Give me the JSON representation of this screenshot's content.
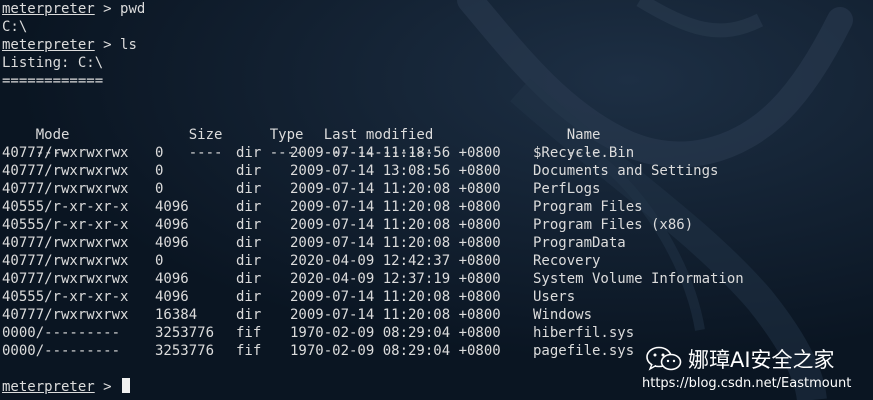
{
  "terminal": {
    "prompt": "meterpreter",
    "prompt_sep": " > ",
    "cmd1": "pwd",
    "out1": "C:\\",
    "cmd2": "ls",
    "listing": "Listing: C:\\",
    "underline": "============",
    "headers": {
      "mode": "Mode",
      "size": "Size",
      "type": "Type",
      "modified": "Last modified",
      "name": "Name"
    },
    "dashes": {
      "mode": "----",
      "size": "----",
      "type": "----",
      "modified": "-------------",
      "name": "----"
    },
    "rows": [
      {
        "mode": "40777/rwxrwxrwx",
        "size": "0",
        "type": "dir",
        "modified": "2009-07-14 11:18:56 +0800",
        "name": "$Recycle.Bin"
      },
      {
        "mode": "40777/rwxrwxrwx",
        "size": "0",
        "type": "dir",
        "modified": "2009-07-14 13:08:56 +0800",
        "name": "Documents and Settings"
      },
      {
        "mode": "40777/rwxrwxrwx",
        "size": "0",
        "type": "dir",
        "modified": "2009-07-14 11:20:08 +0800",
        "name": "PerfLogs"
      },
      {
        "mode": "40555/r-xr-xr-x",
        "size": "4096",
        "type": "dir",
        "modified": "2009-07-14 11:20:08 +0800",
        "name": "Program Files"
      },
      {
        "mode": "40555/r-xr-xr-x",
        "size": "4096",
        "type": "dir",
        "modified": "2009-07-14 11:20:08 +0800",
        "name": "Program Files (x86)"
      },
      {
        "mode": "40777/rwxrwxrwx",
        "size": "4096",
        "type": "dir",
        "modified": "2009-07-14 11:20:08 +0800",
        "name": "ProgramData"
      },
      {
        "mode": "40777/rwxrwxrwx",
        "size": "0",
        "type": "dir",
        "modified": "2020-04-09 12:42:37 +0800",
        "name": "Recovery"
      },
      {
        "mode": "40777/rwxrwxrwx",
        "size": "4096",
        "type": "dir",
        "modified": "2020-04-09 12:37:19 +0800",
        "name": "System Volume Information"
      },
      {
        "mode": "40555/r-xr-xr-x",
        "size": "4096",
        "type": "dir",
        "modified": "2009-07-14 11:20:08 +0800",
        "name": "Users"
      },
      {
        "mode": "40777/rwxrwxrwx",
        "size": "16384",
        "type": "dir",
        "modified": "2009-07-14 11:20:08 +0800",
        "name": "Windows"
      },
      {
        "mode": "0000/---------",
        "size": "3253776",
        "type": "fif",
        "modified": "1970-02-09 08:29:04 +0800",
        "name": "hiberfil.sys"
      },
      {
        "mode": "0000/---------",
        "size": "3253776",
        "type": "fif",
        "modified": "1970-02-09 08:29:04 +0800",
        "name": "pagefile.sys"
      }
    ]
  },
  "watermark": {
    "name": "娜璋AI安全之家",
    "url": "https://blog.csdn.net/Eastmount",
    "icon": "wechat-icon"
  },
  "colors": {
    "background": "#0c1826",
    "text": "#dcdcdc",
    "watermark": "#ffffff"
  }
}
